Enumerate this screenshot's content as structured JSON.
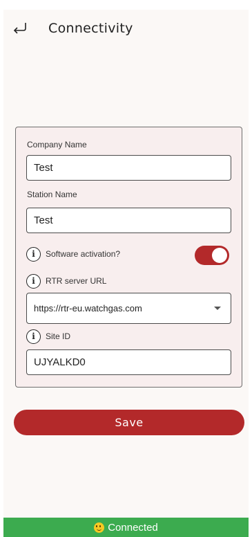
{
  "header": {
    "title": "Connectivity",
    "back_icon": "back-arrow-icon"
  },
  "form": {
    "company_name_label": "Company Name",
    "company_name_value": "Test",
    "station_name_label": "Station Name",
    "station_name_value": "Test",
    "software_activation_label": "Software activation?",
    "software_activation_on": true,
    "rtr_server_label": "RTR server URL",
    "rtr_server_value": "https://rtr-eu.watchgas.com",
    "site_id_label": "Site ID",
    "site_id_value": "UJYALKD0"
  },
  "actions": {
    "save_label": "Save"
  },
  "status": {
    "text": "Connected",
    "icon": "smiley-icon"
  },
  "colors": {
    "accent": "#b3292a",
    "status_ok": "#3cab4f",
    "panel_bg": "#f8eeee"
  }
}
